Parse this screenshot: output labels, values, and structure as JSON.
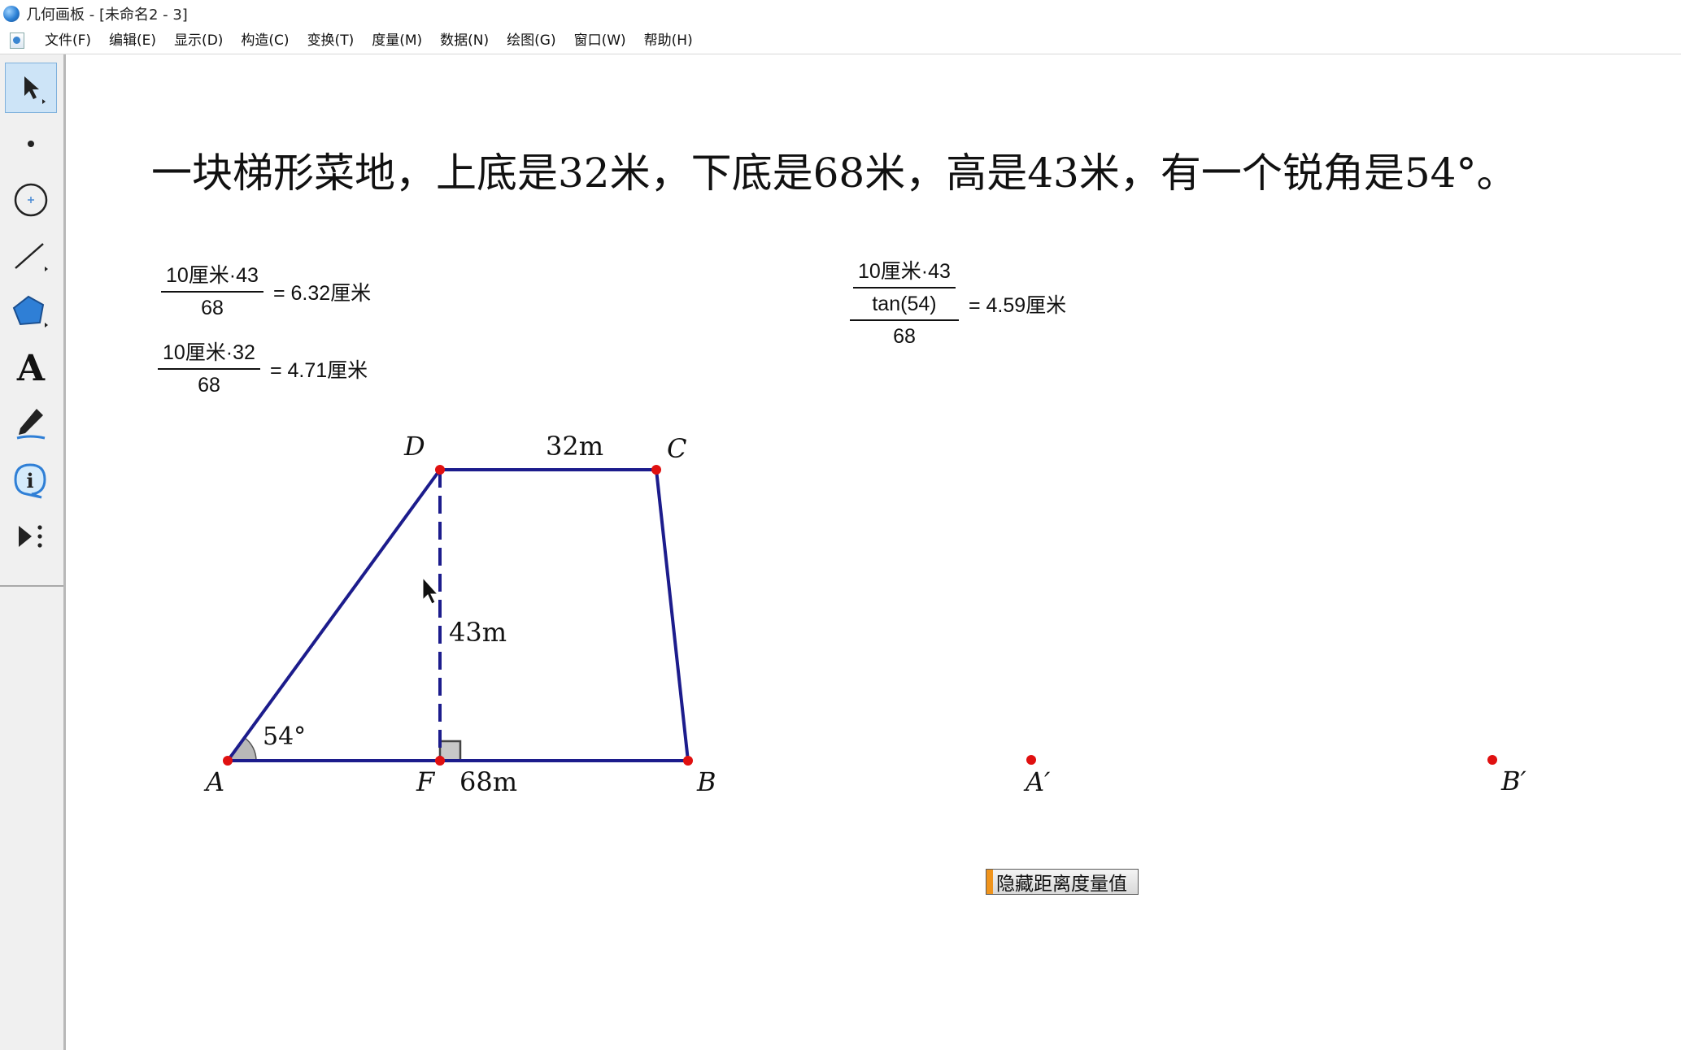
{
  "window": {
    "title": "几何画板 - [未命名2 - 3]"
  },
  "menu": {
    "items": [
      "文件(F)",
      "编辑(E)",
      "显示(D)",
      "构造(C)",
      "变换(T)",
      "度量(M)",
      "数据(N)",
      "绘图(G)",
      "窗口(W)",
      "帮助(H)"
    ]
  },
  "toolbar": {
    "tools": [
      {
        "name": "arrow-tool-icon",
        "active": true
      },
      {
        "name": "point-tool-icon"
      },
      {
        "name": "compass-tool-icon"
      },
      {
        "name": "straightedge-tool-icon"
      },
      {
        "name": "polygon-tool-icon"
      },
      {
        "name": "text-tool-icon",
        "glyph": "A"
      },
      {
        "name": "marker-tool-icon"
      },
      {
        "name": "information-tool-icon",
        "glyph": "i"
      },
      {
        "name": "custom-tool-icon"
      }
    ]
  },
  "problem": {
    "text": "一块梯形菜地，上底是32米，下底是68米，高是43米，有一个锐角是54°。"
  },
  "calculations": [
    {
      "numerator": "10厘米·43",
      "denominator": "68",
      "result": "= 6.32厘米"
    },
    {
      "numerator": "10厘米·32",
      "denominator": "68",
      "result": "= 4.71厘米"
    },
    {
      "numerator": "10厘米·43",
      "middle": "tan(54)",
      "denominator": "68",
      "result": "= 4.59厘米"
    }
  ],
  "figure": {
    "colors": {
      "line": "#1c1c8c",
      "point": "#e01010",
      "angle_fill": "#b0b0b0"
    },
    "points": {
      "A": "A",
      "B": "B",
      "C": "C",
      "D": "D",
      "F": "F",
      "A_prime": "A′",
      "B_prime": "B′"
    },
    "labels": {
      "top": "32m",
      "height": "43m",
      "bottom": "68m",
      "angle": "54°"
    }
  },
  "hide_button": {
    "label": "隐藏距离度量值"
  }
}
